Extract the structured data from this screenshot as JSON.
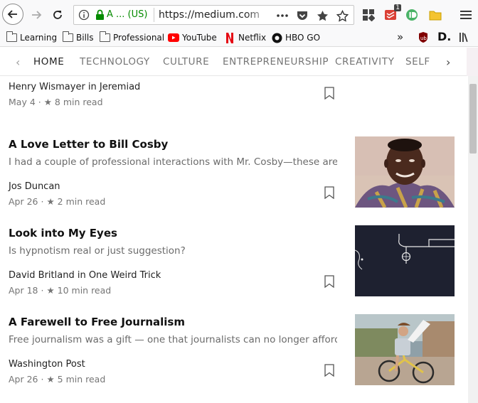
{
  "browser": {
    "url_identity": "A ...  (US)",
    "url": "https://medium.com",
    "extension_badge": "1"
  },
  "bookmarks": [
    {
      "label": "Learning",
      "icon": "folder-icon"
    },
    {
      "label": "Bills",
      "icon": "folder-icon"
    },
    {
      "label": "Professional",
      "icon": "folder-icon"
    },
    {
      "label": "YouTube",
      "icon": "youtube-icon"
    },
    {
      "label": "Netflix",
      "icon": "netflix-icon"
    },
    {
      "label": "HBO GO",
      "icon": "hbo-icon"
    }
  ],
  "topics": [
    "HOME",
    "TECHNOLOGY",
    "CULTURE",
    "ENTREPRENEURSHIP",
    "CREATIVITY",
    "SELF"
  ],
  "articles": [
    {
      "title": "",
      "subtitle": "",
      "author": "Henry Wismayer in Jeremiad",
      "date": "May 4",
      "read_time": "8 min read",
      "has_thumb": false
    },
    {
      "title": "A Love Letter to Bill Cosby",
      "subtitle": "I had a couple of professional interactions with Mr. Cosby—these are the",
      "author": "Jos Duncan",
      "date": "Apr 26",
      "read_time": "2 min read",
      "has_thumb": true
    },
    {
      "title": "Look into My Eyes",
      "subtitle": "Is hypnotism real or just suggestion?",
      "author": "David Britland in One Weird Trick",
      "date": "Apr 18",
      "read_time": "10 min read",
      "has_thumb": true
    },
    {
      "title": "A Farewell to Free Journalism",
      "subtitle": "Free journalism was a gift — one that journalists can no longer afford to keep",
      "author": "Washington Post",
      "date": "Apr 26",
      "read_time": "5 min read",
      "has_thumb": true
    }
  ],
  "meta_separator": "·  ★",
  "colors": {
    "url_green": "#058b00",
    "youtube_red": "#ff0000",
    "netflix_red": "#e50914",
    "dark_thumb": "#1e2130"
  }
}
